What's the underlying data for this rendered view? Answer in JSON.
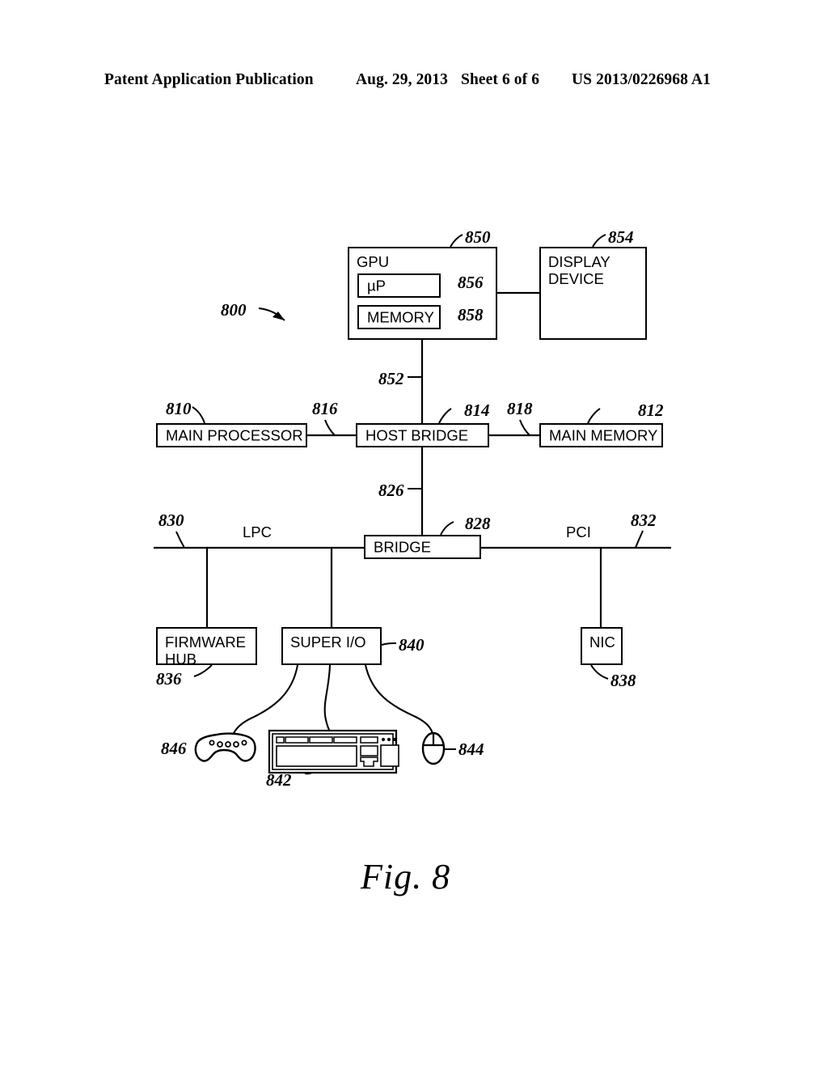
{
  "header": {
    "publication": "Patent Application Publication",
    "date": "Aug. 29, 2013",
    "sheet": "Sheet 6 of 6",
    "patent_number": "US 2013/0226968 A1"
  },
  "figure": {
    "caption": "Fig.  8",
    "system_ref": "800"
  },
  "blocks": [
    {
      "id": "gpu",
      "label": "GPU",
      "ref": "850"
    },
    {
      "id": "gpu_up",
      "label": "µP",
      "ref": "856"
    },
    {
      "id": "gpu_memory",
      "label": "MEMORY",
      "ref": "858"
    },
    {
      "id": "display_device",
      "label": "DISPLAY\nDEVICE",
      "ref": "854"
    },
    {
      "id": "main_processor",
      "label": "MAIN PROCESSOR",
      "ref": "810"
    },
    {
      "id": "host_bridge",
      "label": "HOST BRIDGE",
      "ref": "814"
    },
    {
      "id": "main_memory",
      "label": "MAIN MEMORY",
      "ref": "812"
    },
    {
      "id": "bridge",
      "label": "BRIDGE",
      "ref": "828"
    },
    {
      "id": "firmware_hub",
      "label": "FIRMWARE\nHUB",
      "ref": "836"
    },
    {
      "id": "super_io",
      "label": "SUPER I/O",
      "ref": "840"
    },
    {
      "id": "nic",
      "label": "NIC",
      "ref": "838"
    }
  ],
  "buses": [
    {
      "id": "lpc",
      "label": "LPC",
      "ref": "830"
    },
    {
      "id": "pci",
      "label": "PCI",
      "ref": "832"
    }
  ],
  "links": [
    {
      "id": "gpu_to_host_bridge",
      "ref": "852"
    },
    {
      "id": "main_processor_to_host_bridge",
      "ref": "816"
    },
    {
      "id": "host_bridge_to_main_memory",
      "ref": "818"
    },
    {
      "id": "host_bridge_to_bridge",
      "ref": "826"
    }
  ],
  "peripherals": [
    {
      "id": "gamepad",
      "name": "gamepad-icon",
      "ref": "846"
    },
    {
      "id": "keyboard",
      "name": "keyboard-icon",
      "ref": "842"
    },
    {
      "id": "mouse",
      "name": "mouse-icon",
      "ref": "844"
    }
  ],
  "style": {
    "ink": "#000000",
    "paper": "#ffffff"
  }
}
